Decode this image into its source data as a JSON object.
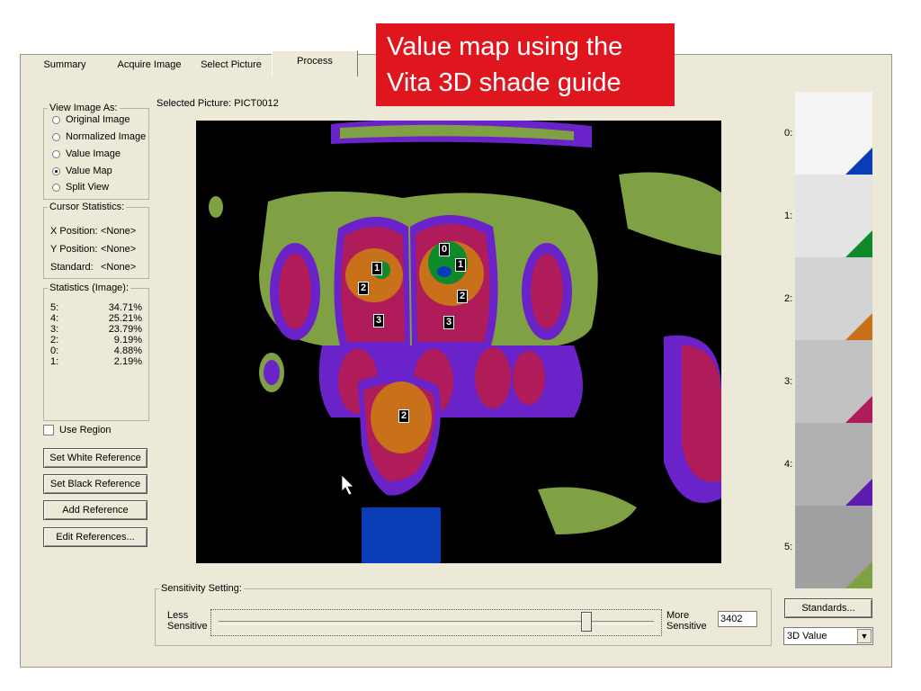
{
  "callout": {
    "line1": "Value map using the",
    "line2": "Vita 3D shade guide"
  },
  "tabs": [
    {
      "label": "Summary",
      "active": false
    },
    {
      "label": "Acquire Image",
      "active": false
    },
    {
      "label": "Select Picture",
      "active": false
    },
    {
      "label": "Process",
      "active": true
    }
  ],
  "view_image_as": {
    "title": "View Image As:",
    "options": [
      {
        "label": "Original Image",
        "selected": false
      },
      {
        "label": "Normalized Image",
        "selected": false
      },
      {
        "label": "Value Image",
        "selected": false
      },
      {
        "label": "Value Map",
        "selected": true
      },
      {
        "label": "Split View",
        "selected": false
      }
    ]
  },
  "selected_picture": "Selected Picture: PICT0012",
  "cursor_statistics": {
    "title": "Cursor Statistics:",
    "x_label": "X Position:",
    "x_value": "<None>",
    "y_label": "Y Position:",
    "y_value": "<None>",
    "std_label": "Standard:",
    "std_value": "<None>"
  },
  "image_statistics": {
    "title": "Statistics (Image):",
    "rows": [
      {
        "k": "5:",
        "v": "34.71%"
      },
      {
        "k": "4:",
        "v": "25.21%"
      },
      {
        "k": "3:",
        "v": "23.79%"
      },
      {
        "k": "2:",
        "v": "9.19%"
      },
      {
        "k": "0:",
        "v": "4.88%"
      },
      {
        "k": "1:",
        "v": "2.19%"
      }
    ]
  },
  "use_region_label": "Use Region",
  "buttons": {
    "set_white": "Set White Reference",
    "set_black": "Set Black Reference",
    "add_reference": "Add Reference",
    "edit_references": "Edit References...",
    "standards": "Standards..."
  },
  "sensitivity": {
    "title": "Sensitivity Setting:",
    "less": "Less",
    "sensitive_left": "Sensitive",
    "more": "More",
    "sensitive_right": "Sensitive",
    "value": "3402",
    "slider_fraction": 0.85
  },
  "shade_scale": {
    "labels": [
      "0:",
      "1:",
      "2:",
      "3:",
      "4:",
      "5:"
    ],
    "swatch_colors": [
      "#f4f4f4",
      "#e4e4e4",
      "#d3d3d3",
      "#c2c2c2",
      "#b1b1b1",
      "#a0a0a0"
    ],
    "marker_colors": [
      "#0b3cb7",
      "#0e8a2a",
      "#c9701a",
      "#b01c5a",
      "#5e1db0",
      "#7fa043"
    ]
  },
  "dropdown_value": "3D Value",
  "map_labels": [
    "0",
    "1",
    "1",
    "2",
    "2",
    "3",
    "3",
    "2"
  ],
  "colors": {
    "map_background": "#000000",
    "green_region": "#7fa043",
    "purple_region": "#6a22c9",
    "magenta_region": "#b01c5a",
    "orange_region": "#c9701a",
    "dark_green_region": "#0e8a2a",
    "blue_region": "#0b3cb7"
  }
}
